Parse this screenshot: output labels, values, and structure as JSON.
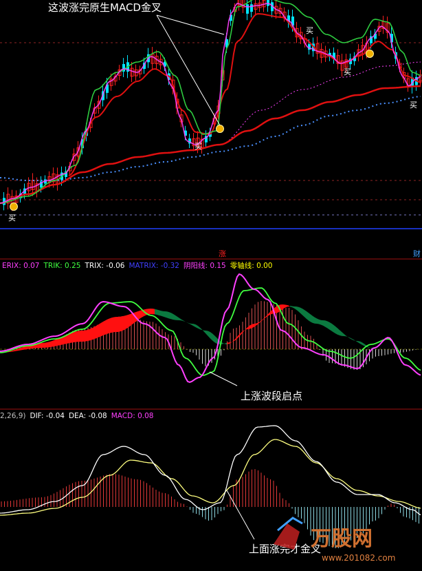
{
  "annotations": {
    "top": "这波涨完原生MACD金叉",
    "middle": "上涨波段启点",
    "bottom": "上面涨完才金叉"
  },
  "panel_labels": {
    "mid_marker": "涨",
    "right_marker": "财"
  },
  "indicator_legend": [
    {
      "text": "ERIX: 0.07",
      "color": "#ff40ff"
    },
    {
      "text": "TRIK: 0.25",
      "color": "#40ff40"
    },
    {
      "text": "TRIX: -0.06",
      "color": "#ffffff"
    },
    {
      "text": "MATRIX: -0.32",
      "color": "#4040ff"
    },
    {
      "text": "阴阳线: 0.15",
      "color": "#ff40ff"
    },
    {
      "text": "零轴线: 0.00",
      "color": "#ffff00"
    }
  ],
  "macd_legend": [
    {
      "text": "2,26,9)",
      "color": "#c0c0c0"
    },
    {
      "text": "DIF: -0.04",
      "color": "#ffffff"
    },
    {
      "text": "DEA: -0.08",
      "color": "#ffffff"
    },
    {
      "text": "MACD: 0.08",
      "color": "#ff40ff"
    }
  ],
  "buy_label": "买",
  "watermark": "万股网",
  "watermark_url": "www.201082.com",
  "colors": {
    "up": "#ff2020",
    "down": "#00e5ff",
    "ma_red": "#e01010",
    "ma_green": "#2ecc40",
    "ma_magenta": "#ff40ff",
    "ma_blue_dots": "#4a90ff",
    "macd_dif": "#ffffff",
    "macd_dea": "#ffff80",
    "band_red": "#ff1010",
    "band_green": "#0b7a40"
  }
}
